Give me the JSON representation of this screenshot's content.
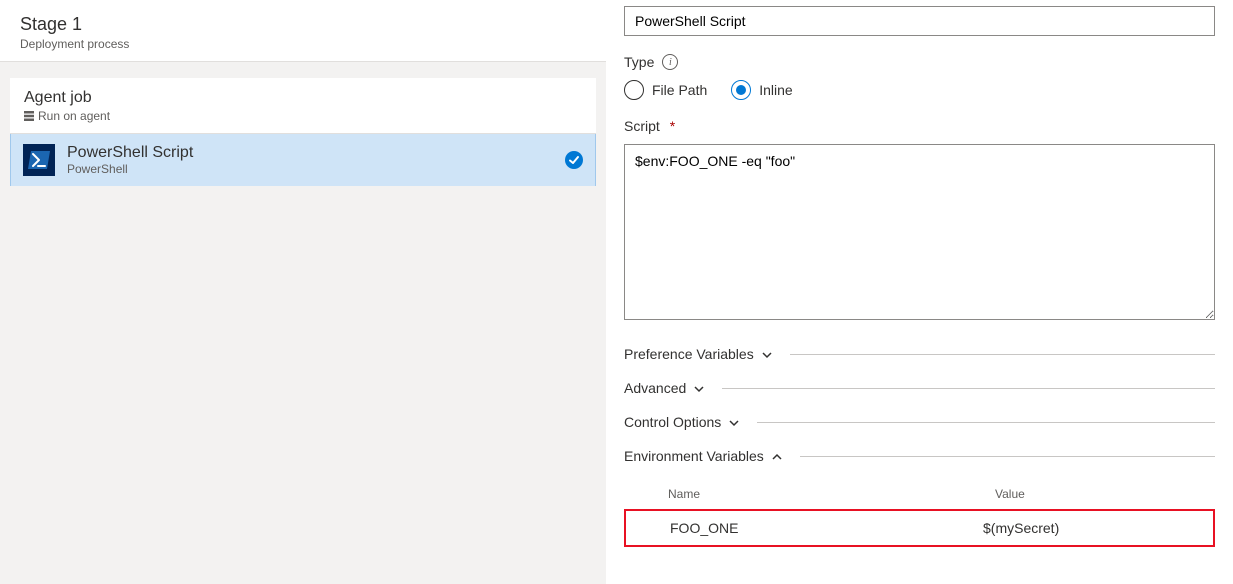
{
  "stage": {
    "title": "Stage 1",
    "subtitle": "Deployment process"
  },
  "agent": {
    "title": "Agent job",
    "subtitle": "Run on agent"
  },
  "task": {
    "name": "PowerShell Script",
    "type": "PowerShell"
  },
  "form": {
    "displayName": "PowerShell Script",
    "typeLabel": "Type",
    "options": {
      "filePath": "File Path",
      "inline": "Inline",
      "selected": "inline"
    },
    "scriptLabel": "Script",
    "scriptValue": "$env:FOO_ONE -eq \"foo\""
  },
  "sections": {
    "preference": "Preference Variables",
    "advanced": "Advanced",
    "control": "Control Options",
    "env": "Environment Variables"
  },
  "envTable": {
    "headers": {
      "name": "Name",
      "value": "Value"
    },
    "rows": [
      {
        "name": "FOO_ONE",
        "value": "$(mySecret)"
      }
    ]
  }
}
